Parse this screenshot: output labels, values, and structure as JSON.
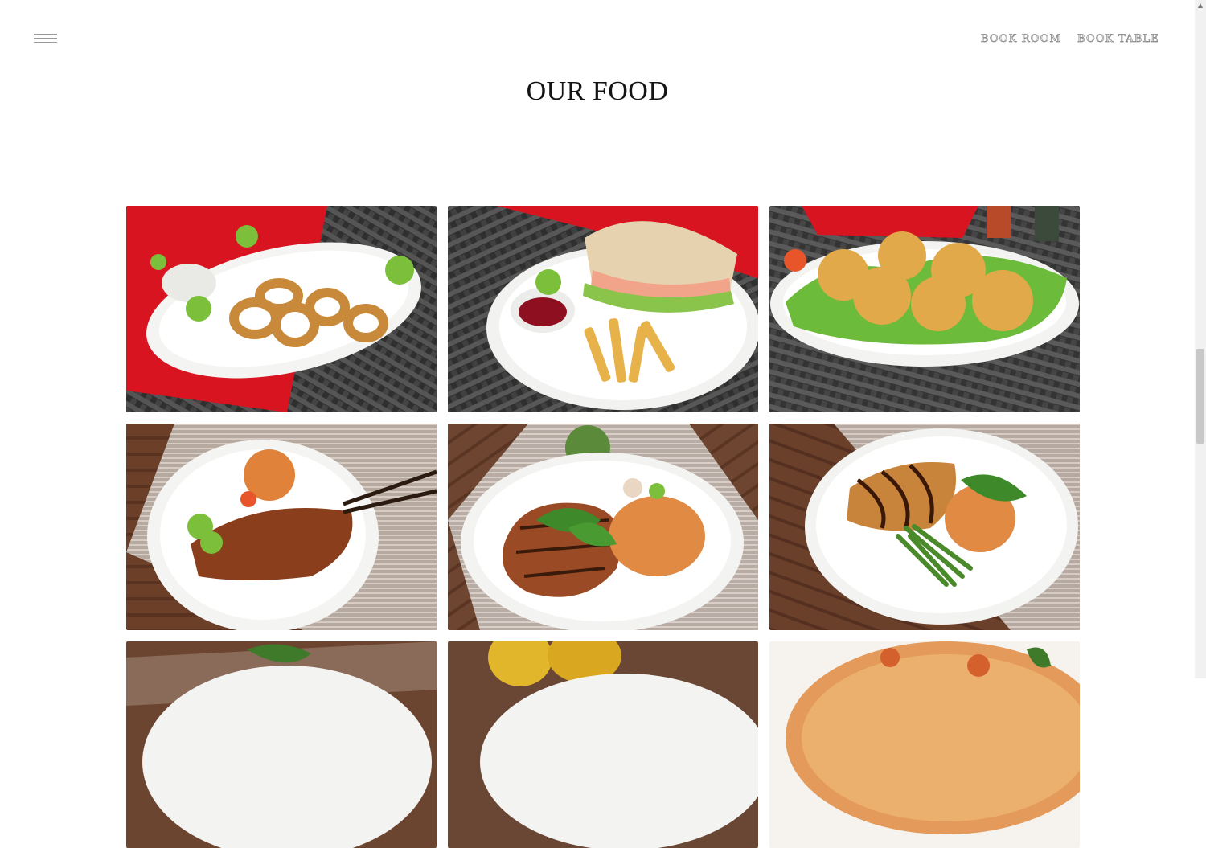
{
  "header": {
    "menu_icon": "hamburger-menu-icon",
    "nav": [
      {
        "label": "BOOK ROOM"
      },
      {
        "label": "BOOK TABLE"
      }
    ]
  },
  "section": {
    "title": "OUR FOOD"
  },
  "gallery": {
    "items": [
      {
        "dish": "fried-calamari-photo"
      },
      {
        "dish": "chicken-sandwich-fries-photo"
      },
      {
        "dish": "fried-balls-salad-photo"
      },
      {
        "dish": "pork-skewers-rice-photo"
      },
      {
        "dish": "grilled-pork-chop-rice-photo"
      },
      {
        "dish": "glazed-fish-green-beans-photo"
      },
      {
        "dish": "dish-partial-photo"
      },
      {
        "dish": "lemons-partial-photo"
      },
      {
        "dish": "pizza-partial-photo"
      }
    ]
  },
  "colors": {
    "title": "#141414",
    "nav_outline": "#8a8a8a",
    "napkin_red": "#d81420",
    "wicker": "#3a3a3a",
    "wood": "#6b3f28"
  }
}
